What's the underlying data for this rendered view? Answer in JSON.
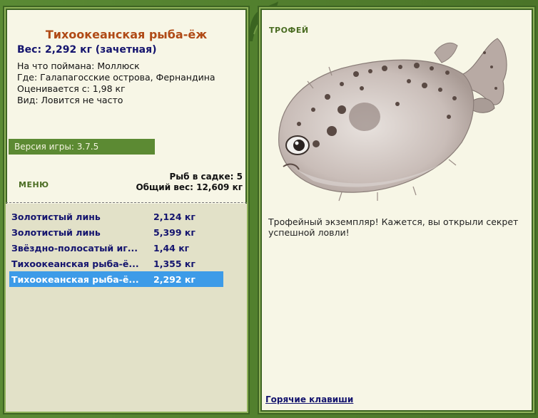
{
  "fish": {
    "title": "Тихоокеанская рыба-ёж",
    "weight_line": "Вес: 2,292 кг (зачетная)",
    "caught_on": "На что поймана: Моллюск",
    "where": "Где: Галапагосские острова, Фернандина",
    "rated_from": "Оценивается с: 1,98 кг",
    "species": "Вид: Ловится не часто"
  },
  "version": "Версия игры: 3.7.5",
  "menu_label": "МЕНЮ",
  "cage": {
    "count": "Рыб в садке: 5",
    "total": "Общий вес: 12,609 кг"
  },
  "catch_list": [
    {
      "name": "Золотистый линь",
      "weight": "2,124 кг"
    },
    {
      "name": "Золотистый линь",
      "weight": "5,399 кг"
    },
    {
      "name": "Звёздно-полосатый иг...",
      "weight": "1,44 кг"
    },
    {
      "name": "Тихоокеанская рыба-ё...",
      "weight": "1,355 кг"
    },
    {
      "name": "Тихоокеанская рыба-ё...",
      "weight": "2,292 кг"
    }
  ],
  "selected_index": 4,
  "trophy": {
    "label": "ТРОФЕЙ",
    "description": "Трофейный экземпляр! Кажется, вы открыли секрет успешной ловли!"
  },
  "hotkeys_label": "Горячие клавиши",
  "colors": {
    "frame_green": "#4e7a2c",
    "panel_bg": "#f7f6e6",
    "title_orange": "#b04a16",
    "text_navy": "#14146e",
    "selection_blue": "#3d9be8"
  }
}
